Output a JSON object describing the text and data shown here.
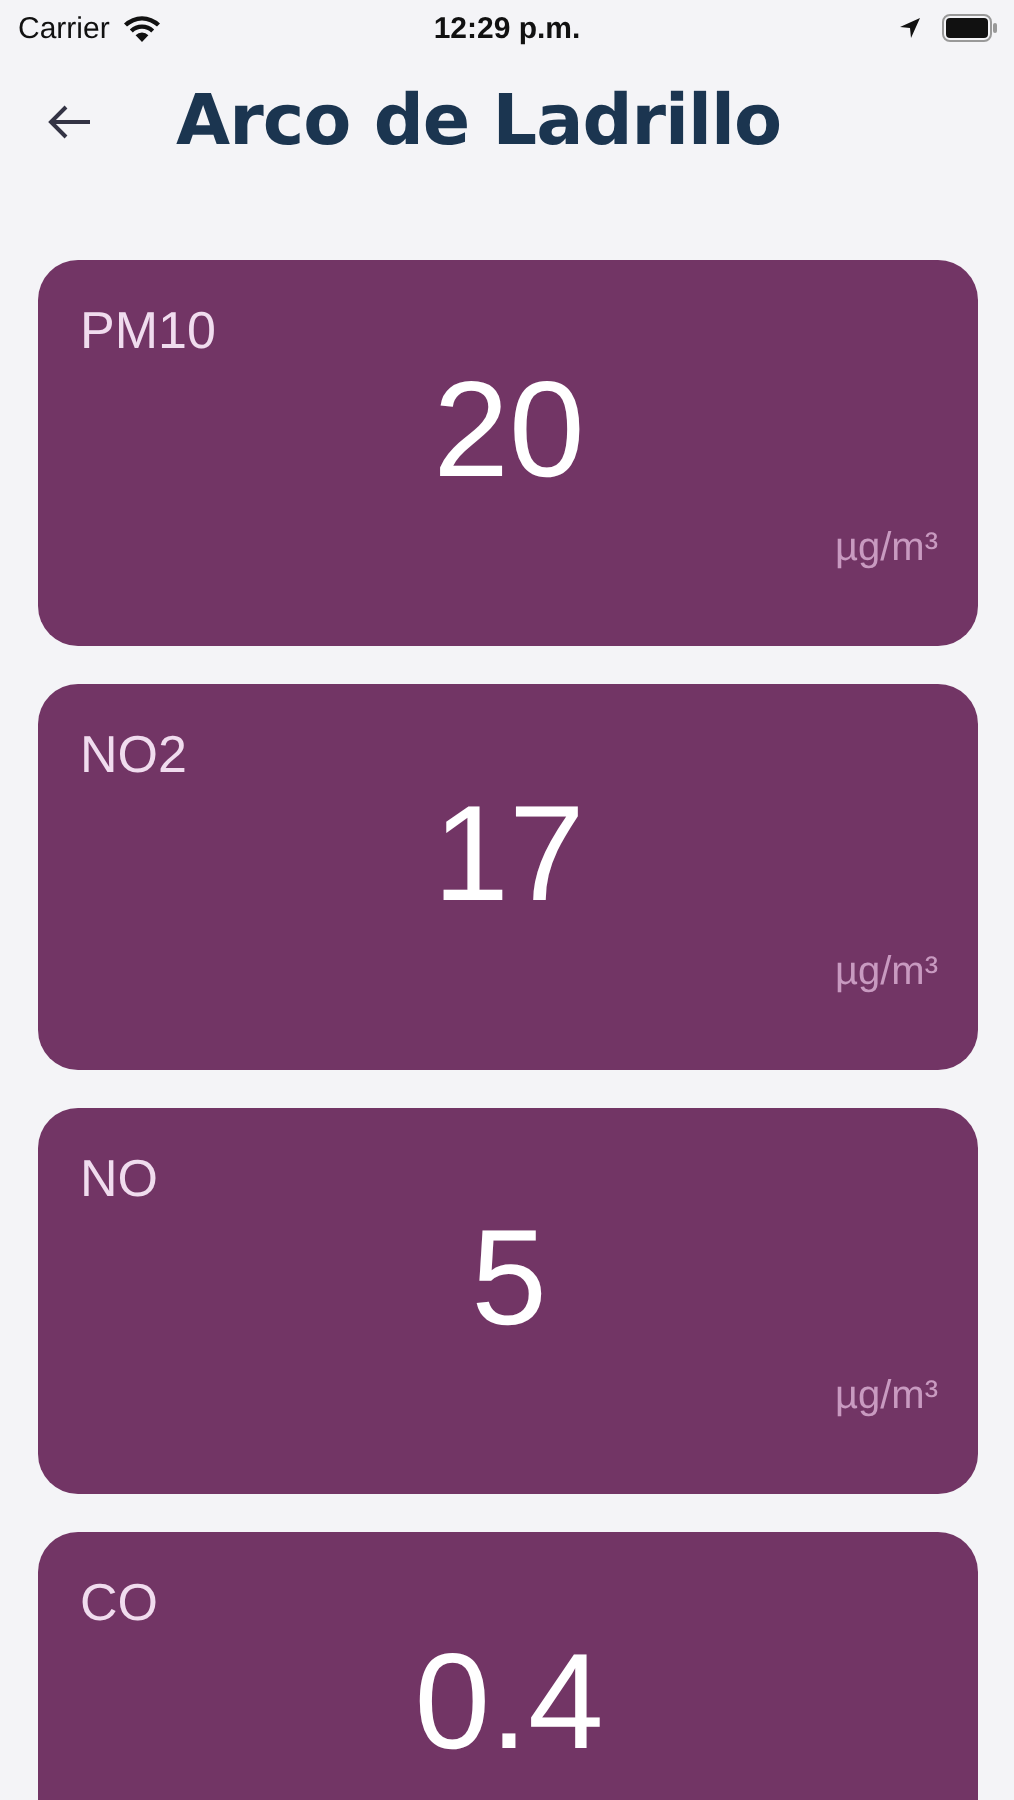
{
  "status_bar": {
    "carrier": "Carrier",
    "time": "12:29 p.m."
  },
  "header": {
    "title": "Arco de Ladrillo"
  },
  "readings": [
    {
      "name": "PM10",
      "value": "20",
      "unit": "µg/m³"
    },
    {
      "name": "NO2",
      "value": "17",
      "unit": "µg/m³"
    },
    {
      "name": "NO",
      "value": "5",
      "unit": "µg/m³"
    },
    {
      "name": "CO",
      "value": "0.4"
    }
  ]
}
